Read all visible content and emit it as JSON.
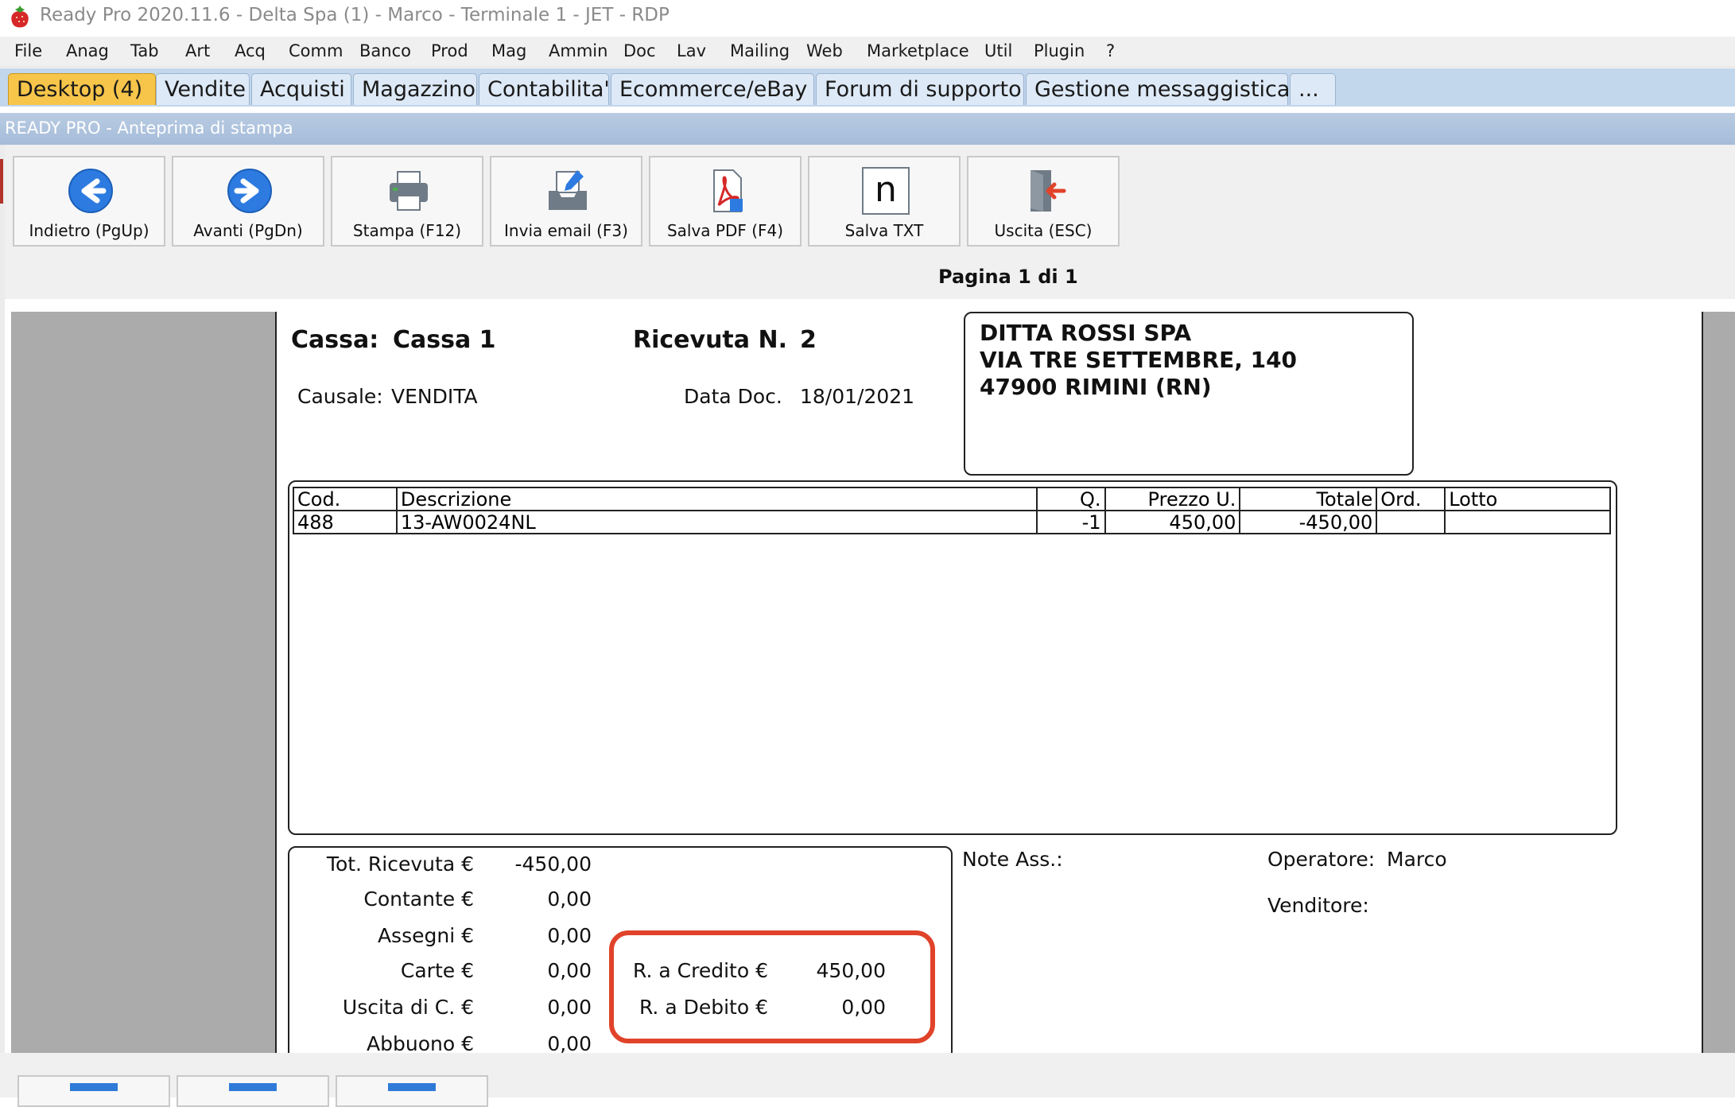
{
  "window": {
    "title": "Ready Pro 2020.11.6 - Delta Spa (1) - Marco - Terminale 1 - JET - RDP"
  },
  "menu": [
    "File",
    "Anag",
    "Tab",
    "Art",
    "Acq",
    "Comm",
    "Banco",
    "Prod",
    "Mag",
    "Ammin",
    "Doc",
    "Lav",
    "Mailing",
    "Web",
    "Marketplace",
    "Util",
    "Plugin",
    "?"
  ],
  "tabs": [
    "Desktop (4)",
    "Vendite",
    "Acquisti",
    "Magazzino",
    "Contabilita'",
    "Ecommerce/eBay",
    "Forum di supporto",
    "Gestione messaggistica",
    "..."
  ],
  "caption": "READY PRO - Anteprima di stampa",
  "toolbar": {
    "buttons": [
      {
        "label": "Indietro (PgUp)",
        "icon": "arrow-left-icon"
      },
      {
        "label": "Avanti (PgDn)",
        "icon": "arrow-right-icon"
      },
      {
        "label": "Stampa (F12)",
        "icon": "printer-icon"
      },
      {
        "label": "Invia email (F3)",
        "icon": "email-tray-icon"
      },
      {
        "label": "Salva PDF (F4)",
        "icon": "pdf-icon"
      },
      {
        "label": "Salva TXT",
        "icon": "txt-icon"
      },
      {
        "label": "Uscita (ESC)",
        "icon": "exit-door-icon"
      }
    ],
    "txt_glyph": "n",
    "page_indicator": "Pagina 1 di 1"
  },
  "doc": {
    "cassa_label": "Cassa:",
    "cassa_value": "Cassa 1",
    "ricevuta_label": "Ricevuta N.",
    "ricevuta_value": "2",
    "causale_label": "Causale:",
    "causale_value": "VENDITA",
    "data_label": "Data Doc.",
    "data_value": "18/01/2021",
    "address": [
      "DITTA ROSSI SPA",
      "VIA TRE SETTEMBRE, 140",
      "47900 RIMINI (RN)"
    ],
    "table": {
      "headers": [
        "Cod.",
        "Descrizione",
        "Q.",
        "Prezzo U.",
        "Totale",
        "Ord.",
        "Lotto"
      ],
      "rows": [
        [
          "488",
          "13-AW0024NL",
          "-1",
          "450,00",
          "-450,00",
          "",
          ""
        ]
      ]
    },
    "totals": [
      {
        "label": "Tot. Ricevuta €",
        "value": "-450,00"
      },
      {
        "label": "Contante €",
        "value": "0,00"
      },
      {
        "label": "Assegni €",
        "value": "0,00"
      },
      {
        "label": "Carte €",
        "value": "0,00"
      },
      {
        "label": "Uscita di C. €",
        "value": "0,00"
      },
      {
        "label": "Abbuono €",
        "value": "0,00"
      }
    ],
    "residui": [
      {
        "label": "R. a Credito €",
        "value": "450,00"
      },
      {
        "label": "R. a Debito €",
        "value": "0,00"
      }
    ],
    "note_label": "Note Ass.:",
    "operatore_label": "Operatore:",
    "operatore_value": "Marco",
    "venditore_label": "Venditore:"
  },
  "colors": {
    "highlight": "#e0432a",
    "active_tab": "#f6c54a",
    "tab_bar": "#c2d6ec"
  }
}
